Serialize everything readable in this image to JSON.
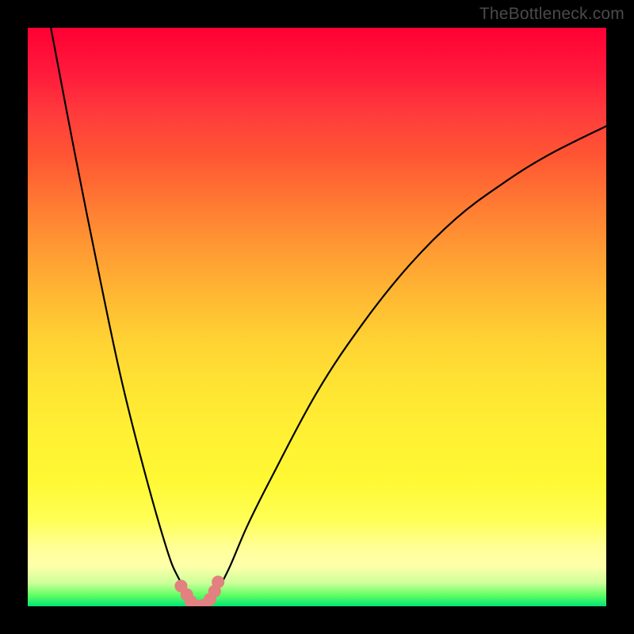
{
  "attribution": "TheBottleneck.com",
  "chart_data": {
    "type": "line",
    "title": "",
    "xlabel": "",
    "ylabel": "",
    "xlim": [
      0,
      100
    ],
    "ylim": [
      0,
      100
    ],
    "series": [
      {
        "name": "bottleneck-curve",
        "x": [
          4,
          8,
          12,
          16,
          20,
          24,
          26,
          28,
          29,
          30,
          31,
          32,
          33,
          35,
          38,
          42,
          50,
          58,
          66,
          74,
          82,
          90,
          100
        ],
        "y": [
          100,
          79,
          59,
          40,
          24,
          10,
          5,
          2,
          0,
          0,
          0,
          1,
          3,
          7,
          14,
          22,
          37,
          49,
          59,
          67,
          73,
          78,
          83
        ]
      }
    ],
    "markers": {
      "name": "minimum-points",
      "x": [
        26.5,
        27.5,
        28.2,
        29.3,
        30.5,
        31.5,
        32.3,
        32.9
      ],
      "y": [
        3.5,
        2.0,
        0.8,
        0.0,
        0.2,
        1.2,
        2.6,
        4.2
      ],
      "color": "#e38080",
      "radius": 8
    },
    "gradient_stops": [
      {
        "pos": 0,
        "color": "#ff0033"
      },
      {
        "pos": 15,
        "color": "#ff3c3c"
      },
      {
        "pos": 38,
        "color": "#ff9933"
      },
      {
        "pos": 62,
        "color": "#ffe433"
      },
      {
        "pos": 85,
        "color": "#ffff55"
      },
      {
        "pos": 96,
        "color": "#ccff99"
      },
      {
        "pos": 100,
        "color": "#00e673"
      }
    ]
  }
}
